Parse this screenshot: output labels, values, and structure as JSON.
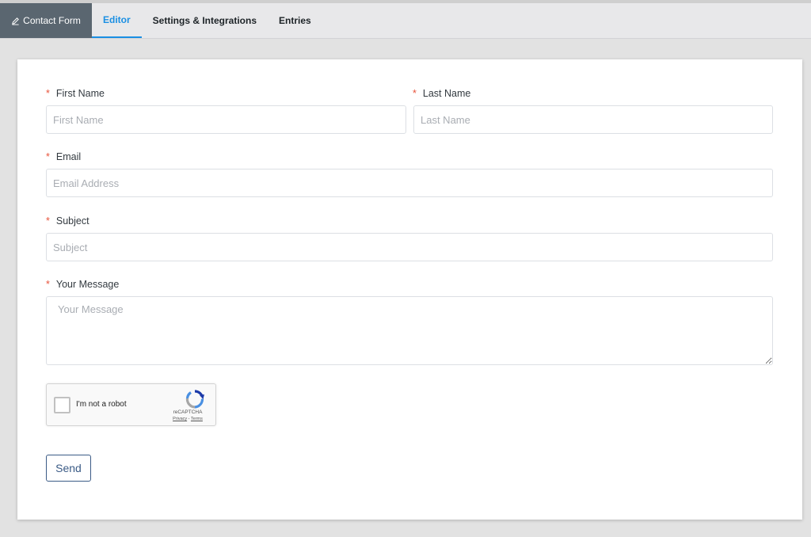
{
  "nav": {
    "brand": "Contact Form",
    "tabs": [
      {
        "label": "Editor",
        "active": true
      },
      {
        "label": "Settings & Integrations",
        "active": false
      },
      {
        "label": "Entries",
        "active": false
      }
    ]
  },
  "form": {
    "required_marker": "*",
    "first_name": {
      "label": "First Name",
      "placeholder": "First Name"
    },
    "last_name": {
      "label": "Last Name",
      "placeholder": "Last Name"
    },
    "email": {
      "label": "Email",
      "placeholder": "Email Address"
    },
    "subject": {
      "label": "Subject",
      "placeholder": "Subject"
    },
    "message": {
      "label": "Your Message",
      "placeholder": "Your Message"
    },
    "recaptcha": {
      "label": "I'm not a robot",
      "brand": "reCAPTCHA",
      "privacy": "Privacy",
      "separator": " - ",
      "terms": "Terms"
    },
    "send_label": "Send"
  },
  "colors": {
    "accent": "#1a8fe3",
    "brand_bg": "#5a6670",
    "required": "#e8533b",
    "send_border": "#3b5b86"
  }
}
